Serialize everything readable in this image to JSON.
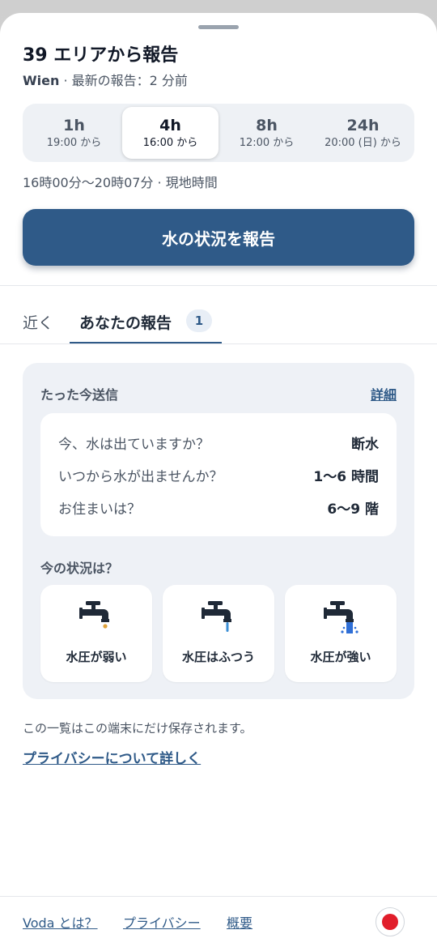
{
  "header": {
    "title": "39 エリアから報告",
    "city": "Wien",
    "subtitle_rest": " · 最新の報告：2 分前"
  },
  "segments": [
    {
      "label": "1h",
      "sub": "19:00 から",
      "active": false
    },
    {
      "label": "4h",
      "sub": "16:00 から",
      "active": true
    },
    {
      "label": "8h",
      "sub": "12:00 から",
      "active": false
    },
    {
      "label": "24h",
      "sub": "20:00 (日) から",
      "active": false
    }
  ],
  "time_range": "16時00分～20時07分 · 現地時間",
  "report_button": "水の状況を報告",
  "tabs": {
    "near": "近く",
    "mine": "あなたの報告",
    "mine_count": "1"
  },
  "report_card": {
    "heading": "たった今送信",
    "detail_link": "詳細",
    "answers": [
      {
        "q": "今、水は出ていますか？",
        "a": "断水"
      },
      {
        "q": "いつから水が出ませんか？",
        "a": "1〜6 時間"
      },
      {
        "q": "お住まいは？",
        "a": "6〜9 階"
      }
    ],
    "status_heading": "今の状況は？",
    "options": [
      {
        "label": "水圧が弱い",
        "icon": "faucet-drip-icon"
      },
      {
        "label": "水圧はふつう",
        "icon": "faucet-flow-icon"
      },
      {
        "label": "水圧が強い",
        "icon": "faucet-strong-icon"
      }
    ]
  },
  "storage_note": "この一覧はこの端末にだけ保存されます。",
  "privacy_link": "プライバシーについて詳しく",
  "footer": {
    "about": "Voda とは？",
    "privacy": "プライバシー",
    "overview": "概要"
  },
  "colors": {
    "accent": "#2f5a88",
    "drip": "#e0a23a",
    "flow": "#3b8fd6",
    "strong": "#2f6fd6",
    "flag_red": "#e11d2a"
  }
}
